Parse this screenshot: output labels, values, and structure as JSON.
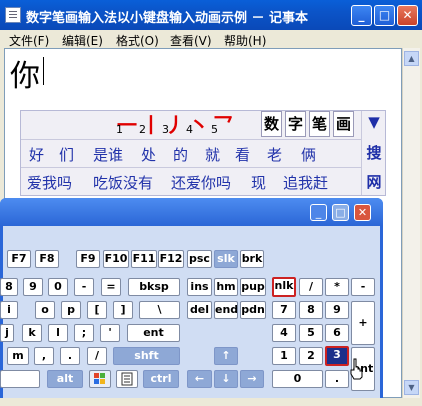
{
  "window": {
    "title": "数字笔画输入法以小键盘输入动画示例 － 记事本",
    "controls": {
      "minimize": "_",
      "maximize": "□",
      "close": "✕"
    }
  },
  "menu": [
    "文件(F)",
    "编辑(E)",
    "格式(O)",
    "查看(V)",
    "帮助(H)"
  ],
  "editor": {
    "text": "你"
  },
  "ime": {
    "strokes": [
      {
        "glyph": "一",
        "num": "1"
      },
      {
        "glyph": "丨",
        "num": "2"
      },
      {
        "glyph": "丿",
        "num": "3"
      },
      {
        "glyph": "丶",
        "num": "4"
      },
      {
        "glyph": "乛",
        "num": "5"
      }
    ],
    "modes": [
      "数",
      "字",
      "笔",
      "画"
    ],
    "candidates_row1": [
      "好",
      "们",
      "是谁",
      "处",
      "的",
      "就",
      "看",
      "老",
      "俩"
    ],
    "candidates_row2": [
      "爱我吗",
      "吃饭没有",
      "还爱你吗",
      "现",
      "追我赶"
    ],
    "side": {
      "arrow": "▼",
      "search": "搜",
      "web": "网"
    }
  },
  "keyboard": {
    "title_buttons": {
      "minimize": "_",
      "maximize": "□",
      "close": "✕"
    },
    "fn_row": [
      "F7",
      "F8",
      "F9",
      "F10",
      "F11",
      "F12",
      "psc",
      "slk",
      "brk"
    ],
    "num_row": [
      "8",
      "9",
      "0",
      "-",
      "=",
      "bksp",
      "ins",
      "hm",
      "pup",
      "nlk",
      "/",
      "*",
      "-"
    ],
    "qwerty_row": [
      "i",
      "o",
      "p",
      "[",
      "]",
      "\\",
      "del",
      "end",
      "pdn",
      "7",
      "8",
      "9",
      "+"
    ],
    "home_row": [
      "j",
      "k",
      "l",
      ";",
      "'",
      "ent",
      "4",
      "5",
      "6"
    ],
    "shift_row": [
      "m",
      ",",
      ".",
      "/",
      "shft",
      "↑",
      "1",
      "2",
      "3",
      "ent"
    ],
    "bottom_row": [
      "alt",
      "ctrl",
      "←",
      "↓",
      "→",
      "0",
      "."
    ],
    "active_key": "nlk",
    "pressed_key": "3"
  },
  "colors": {
    "title_blue": "#0b54c8",
    "candidate_text": "#2233aa",
    "stroke_red": "#e00000",
    "key_highlight": "#cc2222"
  }
}
